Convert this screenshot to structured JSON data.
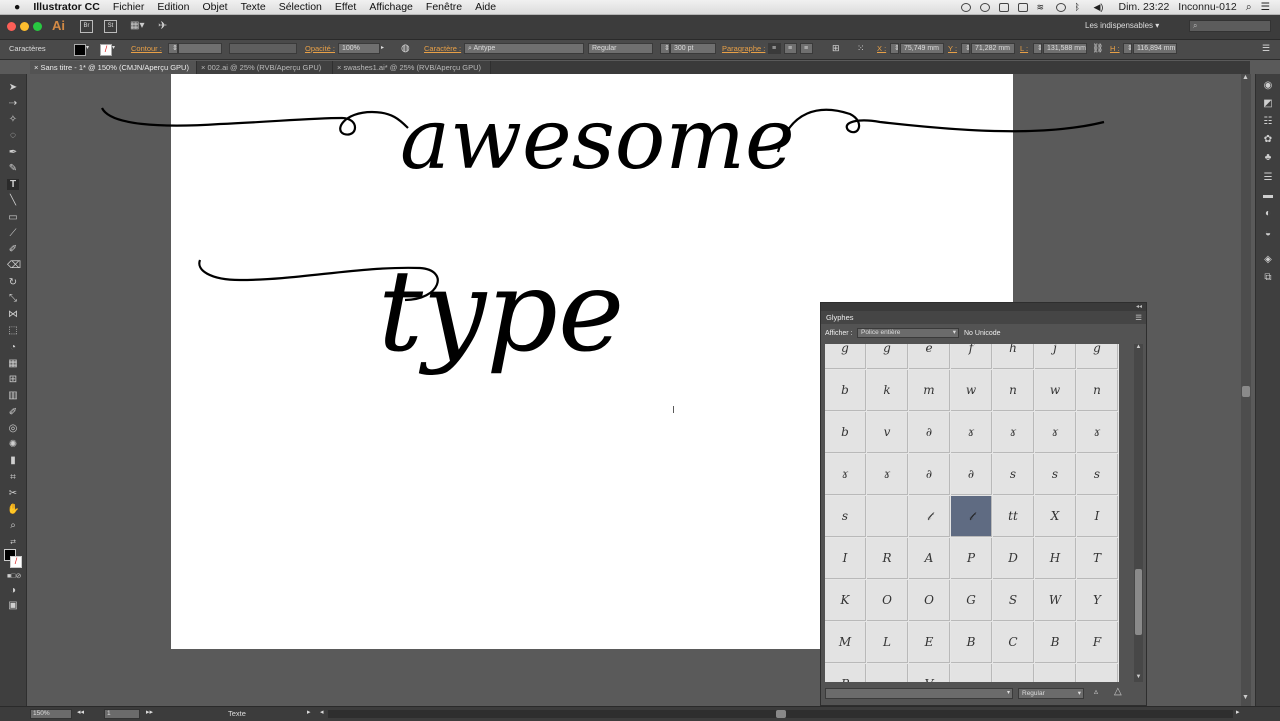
{
  "menubar": {
    "apple": "",
    "app_name": "Illustrator CC",
    "items": [
      "Fichier",
      "Edition",
      "Objet",
      "Texte",
      "Sélection",
      "Effet",
      "Affichage",
      "Fenêtre",
      "Aide"
    ],
    "clock": "Dim. 23:22",
    "user": "Inconnu-012"
  },
  "appbar": {
    "logo": "Ai",
    "br": "Br",
    "st": "St",
    "workspace": "Les indispensables"
  },
  "control_bar": {
    "panel_label": "Caractères",
    "stroke_label": "Contour :",
    "opacity_label": "Opacité :",
    "opacity_value": "100%",
    "character_label": "Caractère :",
    "font_search": "Antype",
    "font_style": "Regular",
    "font_size": "300 pt",
    "paragraph_label": "Paragraphe :",
    "x_label": "X :",
    "x_value": "75,749 mm",
    "y_label": "Y :",
    "y_value": "71,282 mm",
    "w_label": "L :",
    "w_value": "131,588 mm",
    "h_label": "H :",
    "h_value": "116,894 mm"
  },
  "tabs": [
    {
      "label": "Sans titre - 1* @ 150% (CMJN/Aperçu GPU)",
      "active": true
    },
    {
      "label": "002.ai @ 25% (RVB/Aperçu GPU)",
      "active": false
    },
    {
      "label": "swashes1.ai* @ 25% (RVB/Aperçu GPU)",
      "active": false
    }
  ],
  "artwork": {
    "word1": "awesome",
    "word2": "type"
  },
  "glyphs_panel": {
    "title": "Glyphes",
    "show_label": "Afficher :",
    "show_value": "Police entière",
    "unicode": "No Unicode",
    "font_style": "Regular",
    "rows": [
      [
        "g",
        "g",
        "e",
        "f",
        "h",
        "j",
        "g"
      ],
      [
        "b",
        "k",
        "m",
        "w",
        "n",
        "w",
        "n"
      ],
      [
        "b",
        "v",
        "∂",
        "ɤ",
        "ɤ",
        "ɤ",
        "ɤ"
      ],
      [
        "ɤ",
        "ɤ",
        "∂",
        "∂",
        "s",
        "s",
        "s"
      ],
      [
        "s",
        "",
        "𝓉",
        "𝓉",
        "tt",
        "X",
        "I"
      ],
      [
        "I",
        "R",
        "A",
        "P",
        "D",
        "H",
        "T"
      ],
      [
        "K",
        "O",
        "O",
        "G",
        "S",
        "W",
        "Y"
      ],
      [
        "M",
        "L",
        "E",
        "B",
        "C",
        "B",
        "F"
      ],
      [
        "P",
        "",
        "V",
        "",
        "",
        "",
        ""
      ]
    ],
    "selected": [
      4,
      3
    ]
  },
  "status": {
    "zoom": "150%",
    "page": "1",
    "tool": "Texte"
  },
  "colors": {
    "ui_dark": "#3c3c3c",
    "canvas_bg": "#5a5a5a",
    "accent_orange": "#e8a047",
    "selection": "#5f6b82"
  }
}
